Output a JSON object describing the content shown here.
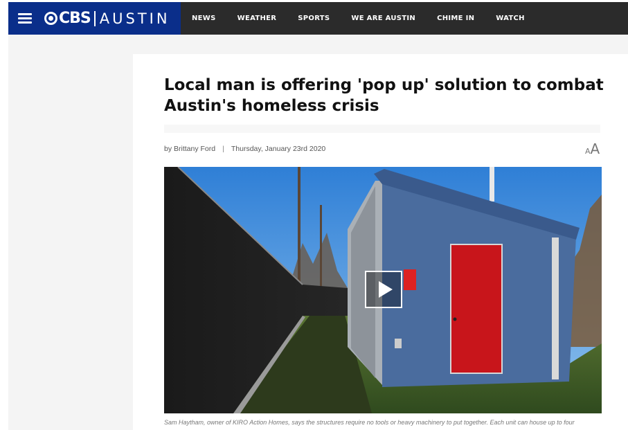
{
  "header": {
    "logo_text": "CBS",
    "station_text": "AUSTIN",
    "nav": [
      "NEWS",
      "WEATHER",
      "SPORTS",
      "WE ARE AUSTIN",
      "CHIME IN",
      "WATCH"
    ]
  },
  "article": {
    "headline": "Local man is offering 'pop up' solution to combat Austin's homeless crisis",
    "author": "by Brittany Ford",
    "separator": "|",
    "date": "Thursday, January 23rd 2020",
    "text_size_small": "A",
    "text_size_large": "A",
    "caption": "Sam Haytham, owner of KIRO Action Homes, says the structures require no tools or heavy machinery to put together. Each unit can house up to four"
  },
  "icons": {
    "menu": "hamburger-menu-icon",
    "play": "play-icon",
    "text_size": "text-size-icon"
  },
  "colors": {
    "brand_blue": "#0a2e8a",
    "nav_bg": "#2b2b2b",
    "door_red": "#c8151b",
    "shed_blue": "#4a6c9e"
  }
}
